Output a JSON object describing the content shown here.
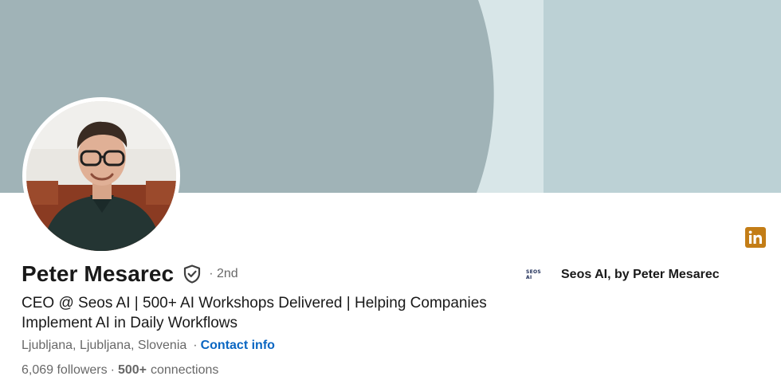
{
  "profile": {
    "name": "Peter Mesarec",
    "degree": "· 2nd",
    "headline": "CEO @ Seos AI | 500+ AI Workshops Delivered | Helping Companies Implement AI in Daily Workflows",
    "location": "Ljubljana, Ljubljana, Slovenia",
    "separator": "·",
    "contact_label": "Contact info",
    "followers": "6,069 followers",
    "connections_count": "500+",
    "connections_label": "connections"
  },
  "company": {
    "logo_text": "SEOS AI",
    "name": "Seos AI, by Peter Mesarec"
  },
  "icons": {
    "verified": "shield-check-icon",
    "linkedin": "linkedin-icon"
  },
  "colors": {
    "banner_primary": "#a0b3b7",
    "banner_secondary": "#bcd1d5",
    "banner_strip": "#d8e6e8",
    "link": "#0a66c2",
    "linkedin_badge": "#c37d16"
  }
}
